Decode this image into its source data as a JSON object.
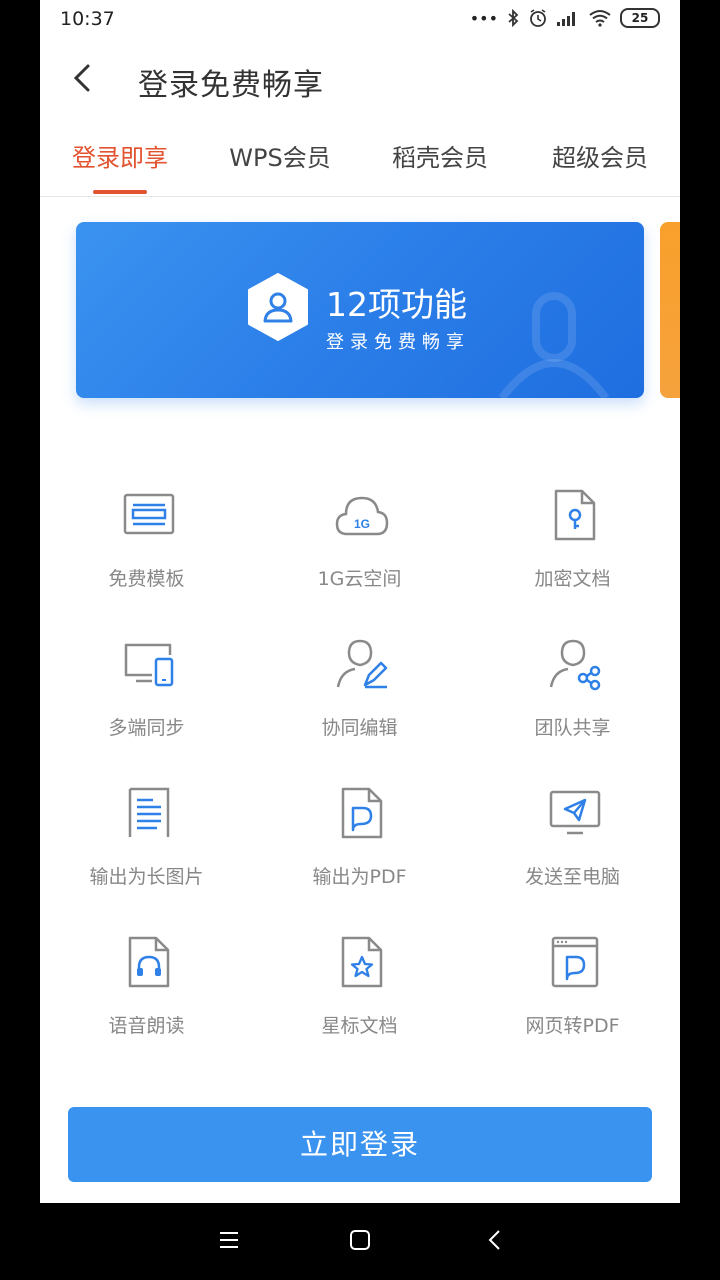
{
  "status_bar": {
    "time": "10:37",
    "battery": "25",
    "icons": [
      "dots-icon",
      "bluetooth-icon",
      "alarm-icon",
      "signal-icon",
      "wifi-icon",
      "battery-icon"
    ]
  },
  "header": {
    "title": "登录免费畅享",
    "back_icon": "chevron-left-icon"
  },
  "tabs": [
    {
      "label": "登录即享",
      "active": true
    },
    {
      "label": "WPS会员",
      "active": false
    },
    {
      "label": "稻壳会员",
      "active": false
    },
    {
      "label": "超级会员",
      "active": false
    }
  ],
  "banner": {
    "headline": "12项功能",
    "subtitle": "登录免费畅享",
    "icon": "user-hexagon-icon"
  },
  "features": [
    {
      "label": "免费模板",
      "icon": "template-icon"
    },
    {
      "label": "1G云空间",
      "icon": "cloud-1g-icon"
    },
    {
      "label": "加密文档",
      "icon": "encrypted-doc-icon"
    },
    {
      "label": "多端同步",
      "icon": "devices-sync-icon"
    },
    {
      "label": "协同编辑",
      "icon": "collaborate-edit-icon"
    },
    {
      "label": "团队共享",
      "icon": "team-share-icon"
    },
    {
      "label": "输出为长图片",
      "icon": "long-image-icon"
    },
    {
      "label": "输出为PDF",
      "icon": "pdf-export-icon"
    },
    {
      "label": "发送至电脑",
      "icon": "send-to-pc-icon"
    },
    {
      "label": "语音朗读",
      "icon": "voice-read-icon"
    },
    {
      "label": "星标文档",
      "icon": "star-doc-icon"
    },
    {
      "label": "网页转PDF",
      "icon": "web-to-pdf-icon"
    }
  ],
  "login_button": {
    "label": "立即登录"
  },
  "colors": {
    "accent": "#e2532f",
    "primary": "#3b93f0",
    "icon_blue": "#2f80e7",
    "icon_gray": "#8a8a8a",
    "label_gray": "#888888"
  },
  "nav_bar": {
    "icons": [
      "menu-icon",
      "home-square-icon",
      "back-icon"
    ]
  }
}
